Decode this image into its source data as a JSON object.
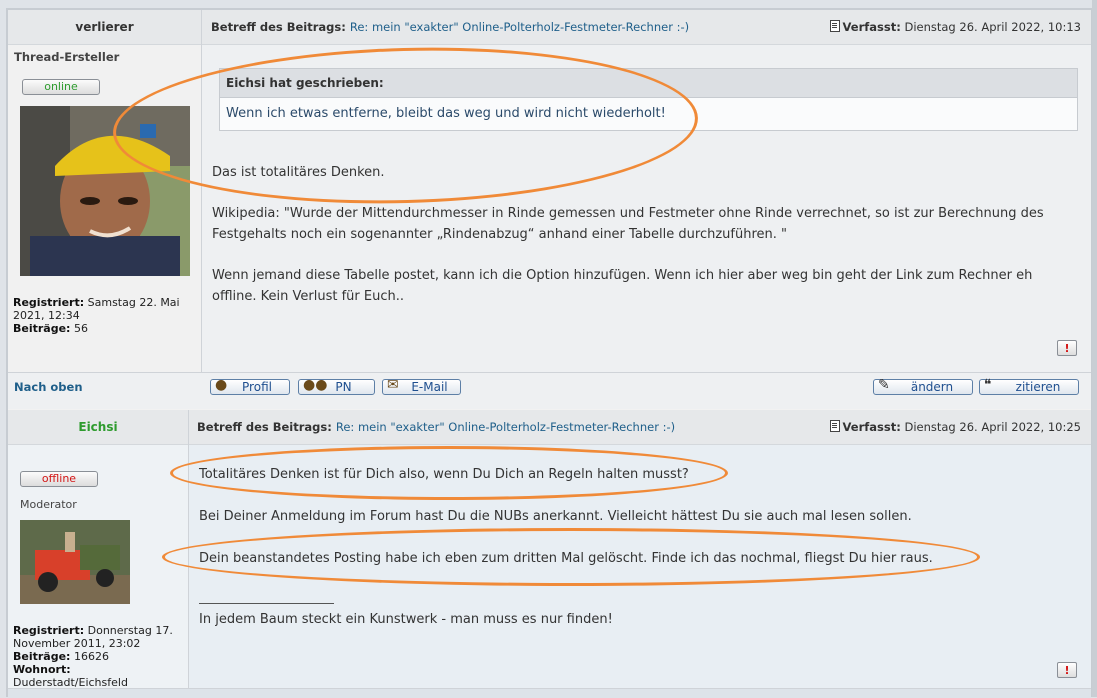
{
  "post1": {
    "author": "verlierer",
    "rank": "Thread-Ersteller",
    "status": "online",
    "subject_label": "Betreff des Beitrags:",
    "subject": "Re: mein \"exakter\" Online-Polterholz-Festmeter-Rechner :-)",
    "posted_label": "Verfasst:",
    "posted": "Dienstag 26. April 2022, 10:13",
    "registered_label": "Registriert:",
    "registered": "Samstag 22. Mai 2021, 12:34",
    "posts_label": "Beiträge:",
    "posts": "56",
    "quote_header": "Eichsi hat geschrieben:",
    "quote_text": "Wenn ich etwas entferne, bleibt das weg und wird nicht wiederholt!",
    "p1": "Das ist totalitäres Denken.",
    "p2": "Wikipedia: \"Wurde der Mittendurchmesser in Rinde gemessen und Festmeter ohne Rinde verrechnet, so ist zur Berechnung des Festgehalts noch ein sogenannter „Rindenabzug“ anhand einer Tabelle durchzuführen. \"",
    "p3": "Wenn jemand diese Tabelle postet, kann ich die Option hinzufügen. Wenn ich hier aber weg bin geht der Link zum Rechner eh offline. Kein Verlust für Euch..",
    "back_to_top": "Nach oben",
    "btn_profile": "Profil",
    "btn_pm": "PN",
    "btn_email": "E-Mail",
    "btn_edit": "ändern",
    "btn_quote": "zitieren",
    "report": "!"
  },
  "post2": {
    "author": "Eichsi",
    "rank": "Moderator",
    "status": "offline",
    "subject_label": "Betreff des Beitrags:",
    "subject": "Re: mein \"exakter\" Online-Polterholz-Festmeter-Rechner :-)",
    "posted_label": "Verfasst:",
    "posted": "Dienstag 26. April 2022, 10:25",
    "registered_label": "Registriert:",
    "registered": "Donnerstag 17. November 2011, 23:02",
    "posts_label": "Beiträge:",
    "posts": "16626",
    "location_label": "Wohnort:",
    "location": "Duderstadt/Eichsfeld",
    "p1": "Totalitäres Denken ist für Dich also, wenn Du Dich an Regeln halten musst?",
    "p2": "Bei Deiner Anmeldung im Forum hast Du die NUBs anerkannt. Vielleicht hättest Du sie auch mal lesen sollen.",
    "p3": "Dein beanstandetes Posting habe ich eben zum dritten Mal gelöscht. Finde ich das nochmal, fliegst Du hier raus.",
    "signature": "In jedem Baum steckt ein Kunstwerk - man muss es nur finden!",
    "report": "!"
  },
  "colors": {
    "annotation": "#f08a38",
    "link": "#1f5f8a",
    "online": "#2e9b2e",
    "offline": "#d31515",
    "moderator_name": "#2e9b2e"
  }
}
